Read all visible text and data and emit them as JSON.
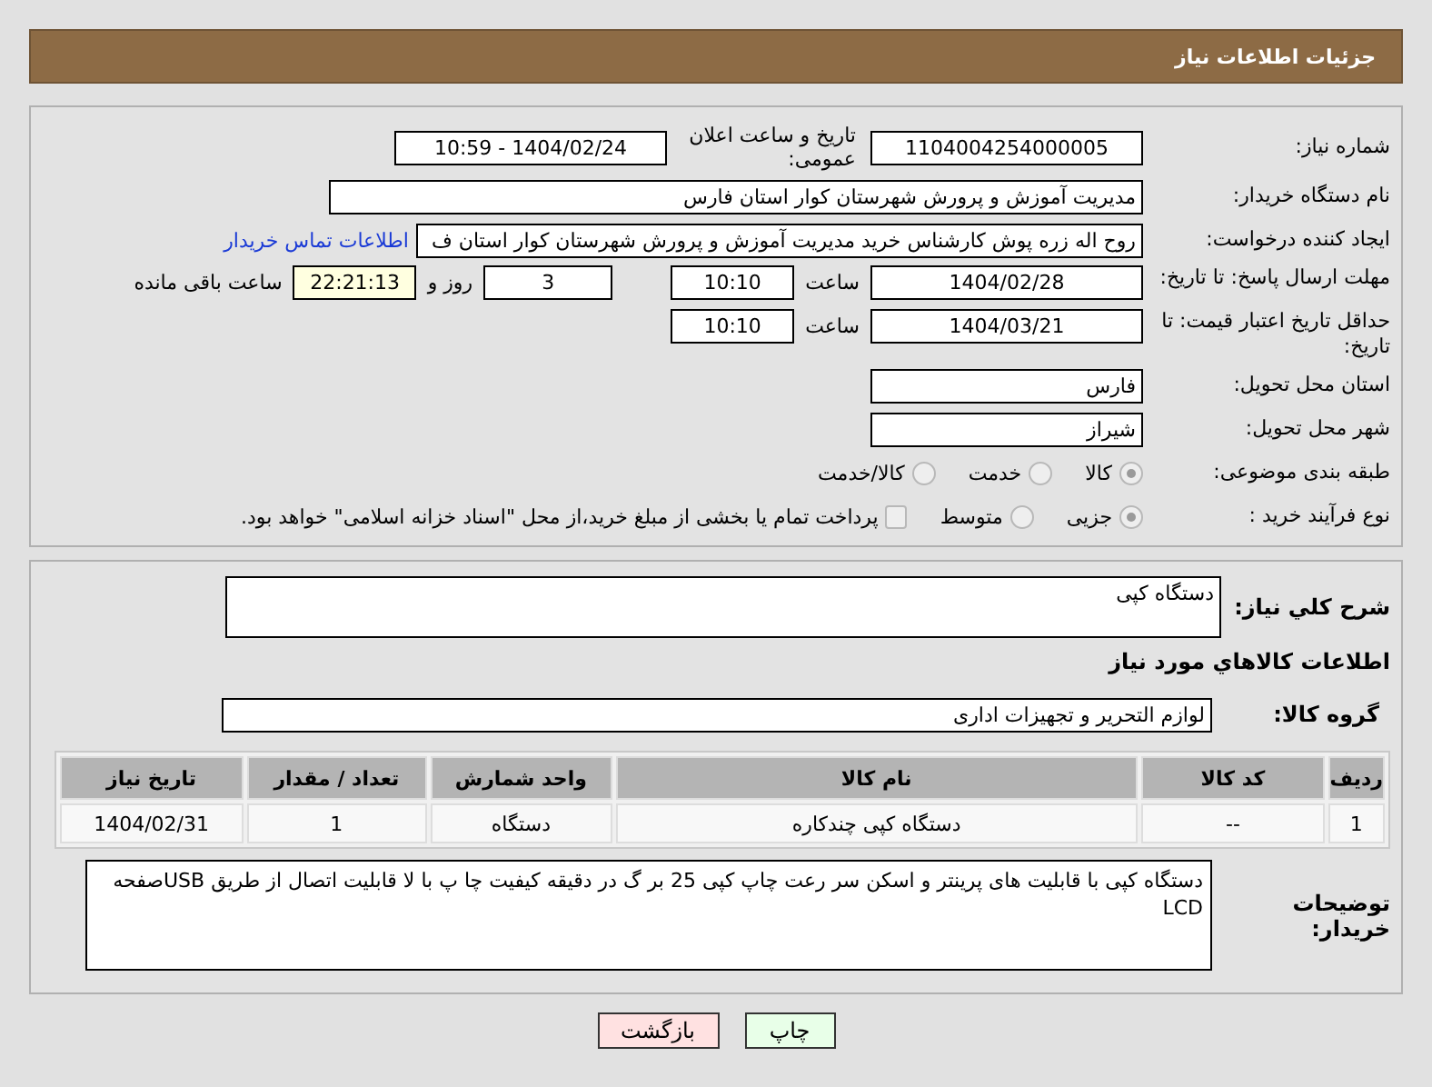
{
  "title": "جزئیات اطلاعات نیاز",
  "need_number": {
    "label": "شماره نیاز:",
    "value": "1104004254000005"
  },
  "announce": {
    "label": "تاریخ و ساعت اعلان عمومی:",
    "value": "1404/02/24 - 10:59"
  },
  "buyer_org": {
    "label": "نام دستگاه خریدار:",
    "value": "مدیریت آموزش و پرورش شهرستان کوار استان فارس"
  },
  "requester": {
    "label": "ایجاد کننده درخواست:",
    "value": "روح اله زره پوش کارشناس خرید مدیریت آموزش و پرورش شهرستان کوار استان ف",
    "link": "اطلاعات تماس خریدار"
  },
  "reply_deadline": {
    "label": "مهلت ارسال پاسخ: تا تاریخ:",
    "date": "1404/02/28",
    "time_label": "ساعت",
    "time": "10:10",
    "days": "3",
    "days_label": "روز و",
    "remaining": "22:21:13",
    "remaining_label": "ساعت باقی مانده"
  },
  "price_validity": {
    "label": "حداقل تاریخ اعتبار قیمت: تا تاریخ:",
    "date": "1404/03/21",
    "time_label": "ساعت",
    "time": "10:10"
  },
  "delivery_province": {
    "label": "استان محل تحویل:",
    "value": "فارس"
  },
  "delivery_city": {
    "label": "شهر محل تحویل:",
    "value": "شیراز"
  },
  "category": {
    "label": "طبقه بندی موضوعی:",
    "options": [
      {
        "label": "کالا",
        "selected": true
      },
      {
        "label": "خدمت",
        "selected": false
      },
      {
        "label": "کالا/خدمت",
        "selected": false
      }
    ]
  },
  "purchase_type": {
    "label": "نوع فرآیند خرید :",
    "options": [
      {
        "label": "جزیی",
        "selected": true
      },
      {
        "label": "متوسط",
        "selected": false
      }
    ],
    "treasury": {
      "label": "پرداخت تمام یا بخشی از مبلغ خرید،از محل \"اسناد خزانه اسلامی\" خواهد بود.",
      "checked": false
    }
  },
  "description": {
    "label": "شرح کلي نیاز:",
    "value": "دستگاه کپی"
  },
  "goods_heading": "اطلاعات کالاهاي مورد نیاز",
  "goods_group": {
    "label": "گروه کالا:",
    "value": "لوازم التحریر و تجهیزات اداری"
  },
  "table": {
    "columns": [
      "ردیف",
      "کد کالا",
      "نام کالا",
      "واحد شمارش",
      "تعداد / مقدار",
      "تاریخ نیاز"
    ],
    "rows": [
      [
        "1",
        "--",
        "دستگاه کپی چندکاره",
        "دستگاه",
        "1",
        "1404/02/31"
      ]
    ]
  },
  "buyer_notes": {
    "label": "توضیحات خریدار:",
    "value": "دستگاه کپی با قابلیت های پرینتر و اسکن سر رعت چاپ کپی 25 بر گ در دقیقه کیفیت چا پ با لا قابلیت اتصال از طریق USBصفحه LCD"
  },
  "buttons": [
    {
      "label": "چاپ",
      "kind": "print"
    },
    {
      "label": "بازگشت",
      "kind": "back"
    }
  ]
}
